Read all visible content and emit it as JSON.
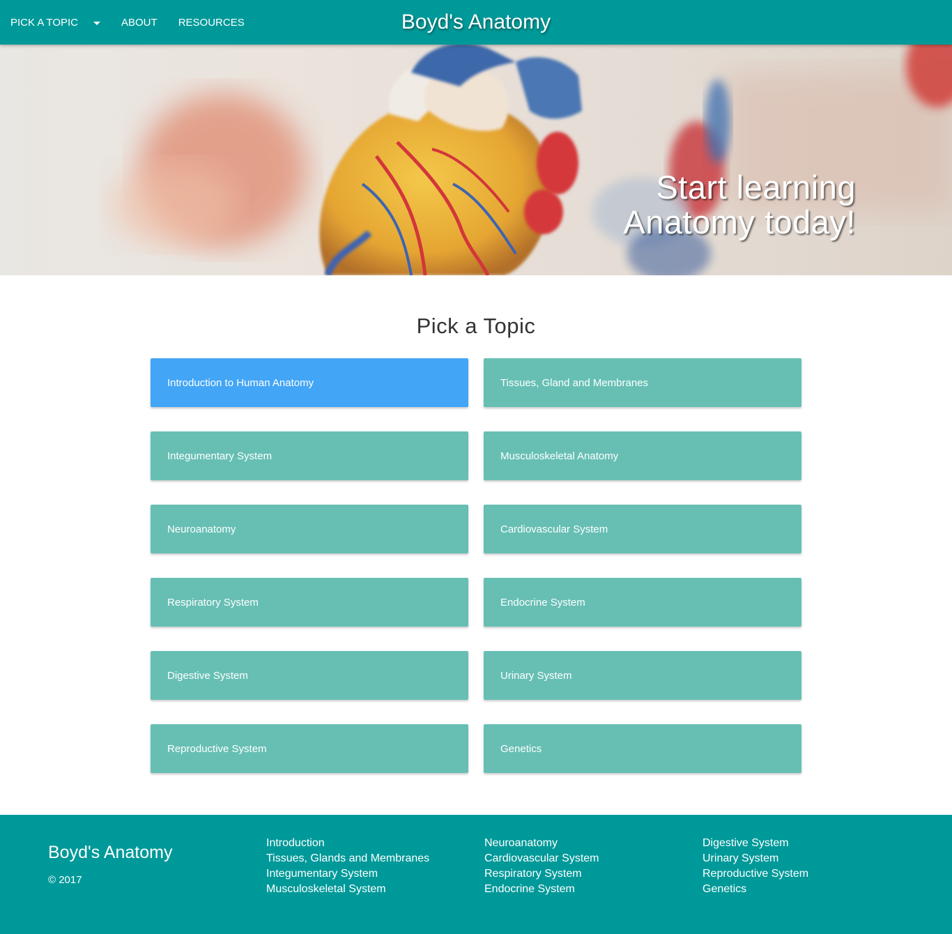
{
  "nav": {
    "pick_topic": "PICK A TOPIC",
    "about": "ABOUT",
    "resources": "RESOURCES",
    "brand": "Boyd's Anatomy"
  },
  "hero": {
    "line1": "Start learning",
    "line2": "Anatomy today!"
  },
  "topics": {
    "title": "Pick a Topic",
    "items": [
      "Introduction to Human Anatomy",
      "Tissues, Gland and Membranes",
      "Integumentary System",
      "Musculoskeletal Anatomy",
      "Neuroanatomy",
      "Cardiovascular System",
      "Respiratory System",
      "Endocrine System",
      "Digestive System",
      "Urinary System",
      "Reproductive System",
      "Genetics"
    ]
  },
  "footer": {
    "brand": "Boyd's Anatomy",
    "copyright": "© 2017",
    "col1": [
      "Introduction",
      "Tissues, Glands and Membranes",
      "Integumentary System",
      "Musculoskeletal System"
    ],
    "col2": [
      "Neuroanatomy",
      "Cardiovascular System",
      "Respiratory System",
      "Endocrine System"
    ],
    "col3": [
      "Digestive System",
      "Urinary System",
      "Reproductive System",
      "Genetics"
    ]
  },
  "colors": {
    "primary": "#009999",
    "card": "#67bfb4",
    "card_active": "#42a5f5"
  }
}
